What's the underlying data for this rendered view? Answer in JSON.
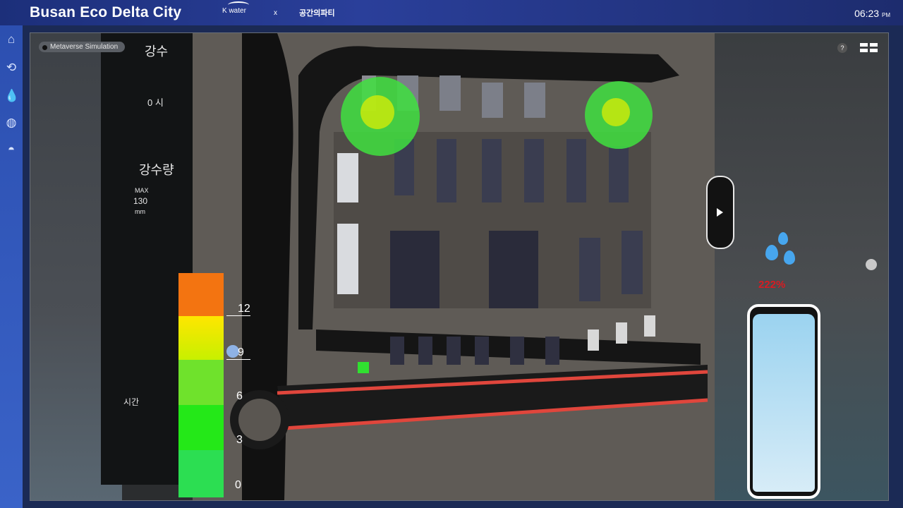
{
  "header": {
    "title_part1": "Busan ",
    "title_part2": "Eco",
    "title_part3": " Delta City",
    "logo_left": "K water",
    "logo_sep": "x",
    "logo_right": "공간의파티",
    "time": "06:23",
    "ampm": "PM"
  },
  "sidebar": {
    "items": [
      {
        "icon": "home-icon"
      },
      {
        "icon": "water-pipe-icon"
      },
      {
        "icon": "water-drops-icon"
      },
      {
        "icon": "globe-icon"
      },
      {
        "icon": "helmet-icon"
      }
    ]
  },
  "panel": {
    "badge": "Metaverse Simulation",
    "label_rain_top": "강수",
    "label_time_top": "0 시",
    "label_rainfall": "강수량",
    "max_label": "MAX",
    "max_value": "130",
    "unit": "mm",
    "time_label": "시간"
  },
  "scale": {
    "ticks": [
      "12",
      "9",
      "6",
      "3",
      "0"
    ],
    "colors": [
      "#ff7a00",
      "#ffe600",
      "#c6f000",
      "#6be22a",
      "#22e316",
      "#2ae05a"
    ]
  },
  "right": {
    "percent": "222%"
  }
}
